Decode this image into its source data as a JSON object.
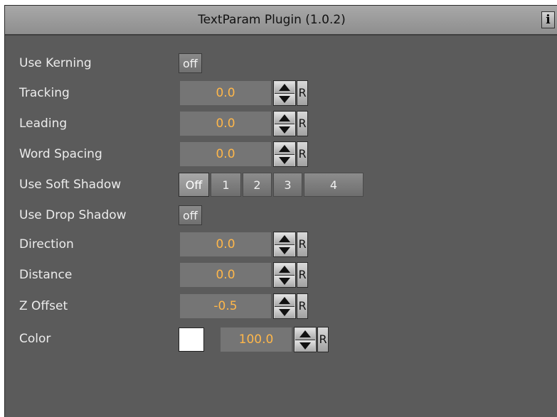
{
  "window": {
    "title": "TextParam Plugin (1.0.2)",
    "info_label": "i"
  },
  "rows": {
    "use_kerning": {
      "label": "Use Kerning",
      "value": "off"
    },
    "tracking": {
      "label": "Tracking",
      "value": "0.0",
      "reset": "R"
    },
    "leading": {
      "label": "Leading",
      "value": "0.0",
      "reset": "R"
    },
    "word_spacing": {
      "label": "Word Spacing",
      "value": "0.0",
      "reset": "R"
    },
    "use_soft_shadow": {
      "label": "Use Soft Shadow",
      "options": [
        "Off",
        "1",
        "2",
        "3",
        "4"
      ],
      "selected": "Off"
    },
    "use_drop_shadow": {
      "label": "Use Drop Shadow",
      "value": "off"
    },
    "direction": {
      "label": "Direction",
      "value": "0.0",
      "reset": "R"
    },
    "distance": {
      "label": "Distance",
      "value": "0.0",
      "reset": "R"
    },
    "z_offset": {
      "label": "Z Offset",
      "value": "-0.5",
      "reset": "R"
    },
    "color": {
      "label": "Color",
      "swatch": "#ffffff",
      "value": "100.0",
      "reset": "R"
    }
  },
  "colors": {
    "panel_bg": "#5b5b5b",
    "value_text": "#ffb74a",
    "field_bg": "#757575"
  }
}
